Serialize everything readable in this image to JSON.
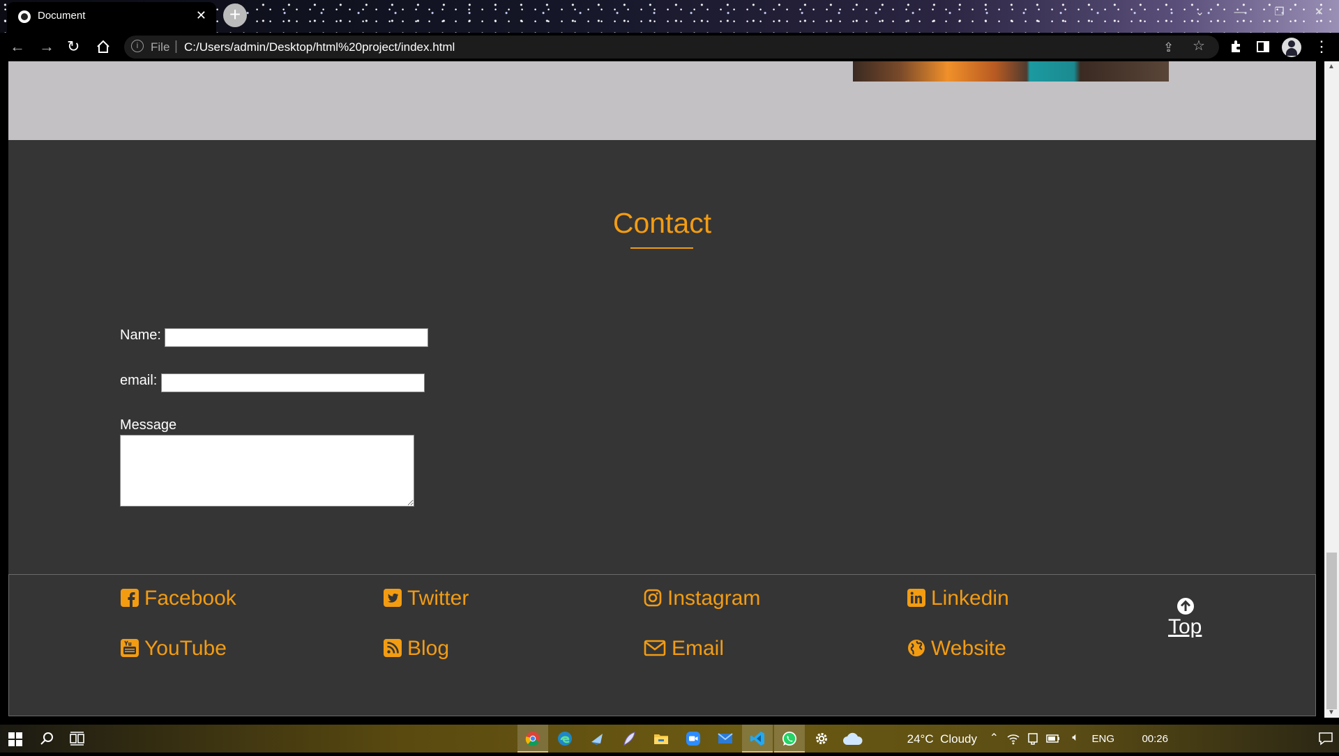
{
  "browser": {
    "tab_title": "Document",
    "tab_close": "✕",
    "new_tab": "+",
    "window_controls": {
      "chevron": "⌄",
      "minimize": "—",
      "restore": "❐",
      "close": "✕"
    },
    "address": {
      "scheme_label": "File",
      "separator": "|",
      "url": "C:/Users/admin/Desktop/html%20project/index.html"
    },
    "icons": [
      "back-icon",
      "forward-icon",
      "reload-icon",
      "home-icon",
      "info-icon",
      "share-icon",
      "star-icon",
      "extensions-icon",
      "sidepanel-icon",
      "profile-icon",
      "menu-icon"
    ]
  },
  "contact": {
    "title": "Contact",
    "name_label": "Name:",
    "email_label": "email:",
    "message_label": "Message",
    "name_value": "",
    "email_value": "",
    "message_value": ""
  },
  "footer": {
    "links": [
      {
        "label": "Facebook",
        "icon": "facebook-icon"
      },
      {
        "label": "Twitter",
        "icon": "twitter-icon"
      },
      {
        "label": "Instagram",
        "icon": "instagram-icon"
      },
      {
        "label": "Linkedin",
        "icon": "linkedin-icon"
      },
      {
        "label": "YouTube",
        "icon": "youtube-icon"
      },
      {
        "label": "Blog",
        "icon": "rss-icon"
      },
      {
        "label": "Email",
        "icon": "envelope-icon"
      },
      {
        "label": "Website",
        "icon": "globe-icon"
      }
    ],
    "top_label": "Top"
  },
  "taskbar": {
    "weather": "24°C  Cloudy",
    "language": "ENG",
    "time": "00:26",
    "apps": [
      "chrome",
      "edge",
      "app3",
      "app4",
      "file-explorer",
      "zoom",
      "mail",
      "vscode",
      "whatsapp",
      "settings"
    ]
  },
  "colors": {
    "accent": "#f39c12",
    "section_bg": "#353535",
    "hero_bg": "#c4c1c4"
  }
}
